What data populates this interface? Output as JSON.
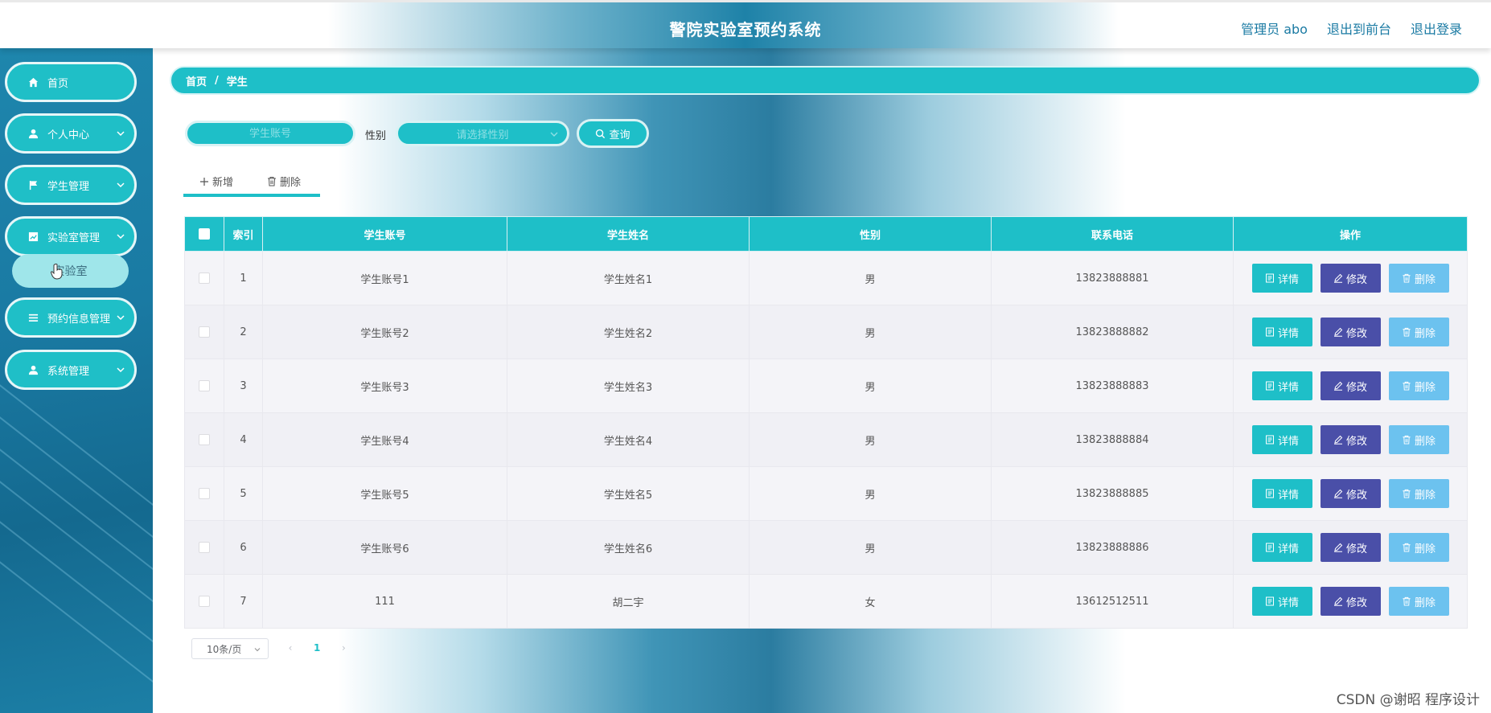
{
  "app": {
    "title": "警院实验室预约系统"
  },
  "header": {
    "user_label": "管理员 abo",
    "front_label": "退出到前台",
    "logout_label": "退出登录"
  },
  "sidebar": {
    "items": [
      {
        "label": "首页",
        "icon": "home-icon"
      },
      {
        "label": "个人中心",
        "icon": "user-icon"
      },
      {
        "label": "学生管理",
        "icon": "flag-icon"
      },
      {
        "label": "实验室管理",
        "icon": "chart-icon"
      },
      {
        "label": "预约信息管理",
        "icon": "list-icon"
      },
      {
        "label": "系统管理",
        "icon": "user-icon"
      }
    ],
    "submenu": {
      "label": "实验室"
    }
  },
  "breadcrumb": {
    "home": "首页",
    "separator": "/",
    "current": "学生"
  },
  "search": {
    "account_placeholder": "学生账号",
    "gender_label": "性别",
    "gender_placeholder": "请选择性别",
    "query_label": "查询"
  },
  "toolbar": {
    "add_label": "新增",
    "delete_label": "删除"
  },
  "table": {
    "columns": [
      "索引",
      "学生账号",
      "学生姓名",
      "性别",
      "联系电话",
      "操作"
    ],
    "actions": {
      "detail": "详情",
      "edit": "修改",
      "delete": "删除"
    },
    "rows": [
      {
        "index": "1",
        "account": "学生账号1",
        "name": "学生姓名1",
        "gender": "男",
        "phone": "13823888881"
      },
      {
        "index": "2",
        "account": "学生账号2",
        "name": "学生姓名2",
        "gender": "男",
        "phone": "13823888882"
      },
      {
        "index": "3",
        "account": "学生账号3",
        "name": "学生姓名3",
        "gender": "男",
        "phone": "13823888883"
      },
      {
        "index": "4",
        "account": "学生账号4",
        "name": "学生姓名4",
        "gender": "男",
        "phone": "13823888884"
      },
      {
        "index": "5",
        "account": "学生账号5",
        "name": "学生姓名5",
        "gender": "男",
        "phone": "13823888885"
      },
      {
        "index": "6",
        "account": "学生账号6",
        "name": "学生姓名6",
        "gender": "男",
        "phone": "13823888886"
      },
      {
        "index": "7",
        "account": "111",
        "name": "胡二宇",
        "gender": "女",
        "phone": "13612512511"
      }
    ]
  },
  "pagination": {
    "page_size": "10条/页",
    "current_page": "1",
    "prev": "‹",
    "next": "›"
  },
  "watermark": "CSDN @谢昭  程序设计",
  "colors": {
    "accent": "#1ebfc8",
    "sidebar_bg": "#1a7aa3",
    "edit_button": "#4a4fa8",
    "delete_button": "#6cc2ef"
  }
}
